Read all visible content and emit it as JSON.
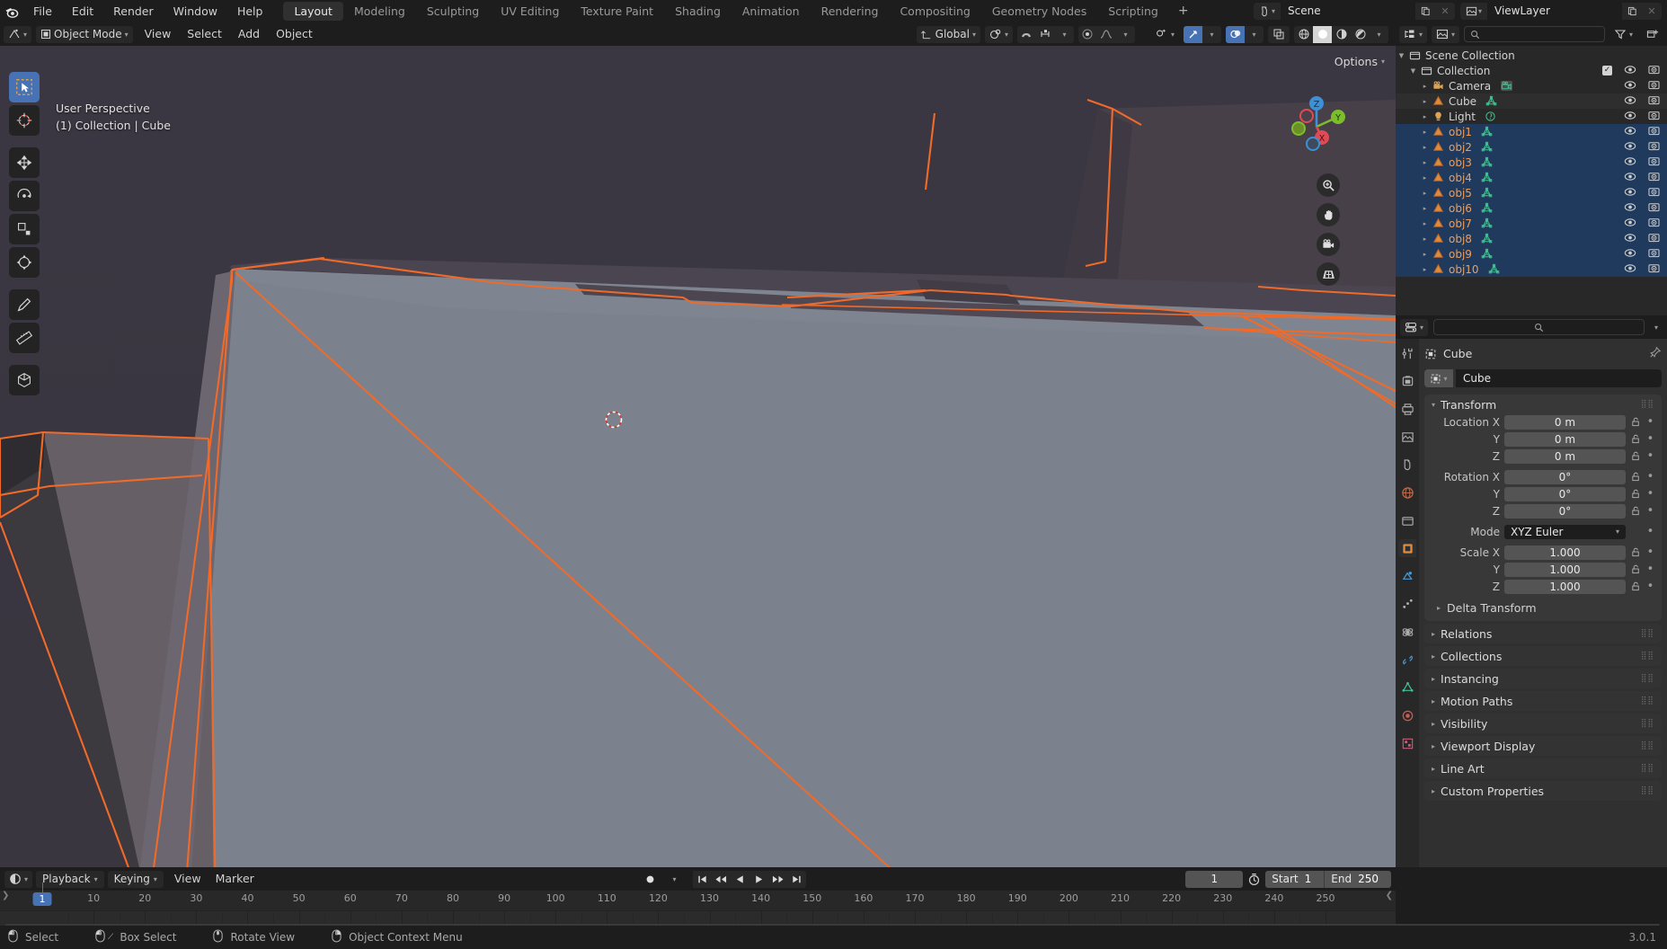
{
  "app": {
    "version": "3.0.1",
    "theme_bg": "#1d1d1d",
    "accent": "#4772b3",
    "select_orange": "#ed9e5c"
  },
  "topbar": {
    "menus": [
      "File",
      "Edit",
      "Render",
      "Window",
      "Help"
    ],
    "workspaces": [
      {
        "label": "Layout",
        "active": true
      },
      {
        "label": "Modeling",
        "active": false
      },
      {
        "label": "Sculpting",
        "active": false
      },
      {
        "label": "UV Editing",
        "active": false
      },
      {
        "label": "Texture Paint",
        "active": false
      },
      {
        "label": "Shading",
        "active": false
      },
      {
        "label": "Animation",
        "active": false
      },
      {
        "label": "Rendering",
        "active": false
      },
      {
        "label": "Compositing",
        "active": false
      },
      {
        "label": "Geometry Nodes",
        "active": false
      },
      {
        "label": "Scripting",
        "active": false
      }
    ],
    "add_workspace": "+",
    "scene_name": "Scene",
    "viewlayer_name": "ViewLayer"
  },
  "viewport": {
    "mode": "Object Mode",
    "menus": [
      "View",
      "Select",
      "Add",
      "Object"
    ],
    "transform_orientation": "Global",
    "options_label": "Options",
    "overlay_text_line1": "User Perspective",
    "overlay_text_line2": "(1) Collection | Cube",
    "gizmo_axes": {
      "x": "X",
      "y": "Y",
      "z": "Z"
    }
  },
  "outliner": {
    "search_placeholder": "",
    "root": "Scene Collection",
    "collection": "Collection",
    "rows": [
      {
        "label": "Camera",
        "icon": "camera-icon",
        "data_icon": "camera-data-icon",
        "selected": false,
        "active": false,
        "indent": 2
      },
      {
        "label": "Cube",
        "icon": "mesh-icon",
        "data_icon": "mesh-data-icon",
        "selected": false,
        "active": true,
        "indent": 2
      },
      {
        "label": "Light",
        "icon": "light-icon",
        "data_icon": "light-data-icon",
        "selected": false,
        "active": false,
        "indent": 2
      },
      {
        "label": "obj1",
        "icon": "mesh-icon",
        "data_icon": "mesh-data-icon",
        "selected": true,
        "active": false,
        "indent": 2
      },
      {
        "label": "obj2",
        "icon": "mesh-icon",
        "data_icon": "mesh-data-icon",
        "selected": true,
        "active": false,
        "indent": 2
      },
      {
        "label": "obj3",
        "icon": "mesh-icon",
        "data_icon": "mesh-data-icon",
        "selected": true,
        "active": false,
        "indent": 2
      },
      {
        "label": "obj4",
        "icon": "mesh-icon",
        "data_icon": "mesh-data-icon",
        "selected": true,
        "active": false,
        "indent": 2
      },
      {
        "label": "obj5",
        "icon": "mesh-icon",
        "data_icon": "mesh-data-icon",
        "selected": true,
        "active": false,
        "indent": 2
      },
      {
        "label": "obj6",
        "icon": "mesh-icon",
        "data_icon": "mesh-data-icon",
        "selected": true,
        "active": false,
        "indent": 2
      },
      {
        "label": "obj7",
        "icon": "mesh-icon",
        "data_icon": "mesh-data-icon",
        "selected": true,
        "active": false,
        "indent": 2
      },
      {
        "label": "obj8",
        "icon": "mesh-icon",
        "data_icon": "mesh-data-icon",
        "selected": true,
        "active": false,
        "indent": 2
      },
      {
        "label": "obj9",
        "icon": "mesh-icon",
        "data_icon": "mesh-data-icon",
        "selected": true,
        "active": false,
        "indent": 2
      },
      {
        "label": "obj10",
        "icon": "mesh-icon",
        "data_icon": "mesh-data-icon",
        "selected": true,
        "active": false,
        "indent": 2
      }
    ]
  },
  "properties": {
    "breadcrumb_object": "Cube",
    "object_name": "Cube",
    "transform": {
      "title": "Transform",
      "location_label": "Location X",
      "rotation_label": "Rotation X",
      "scale_label": "Scale X",
      "axis_y": "Y",
      "axis_z": "Z",
      "location": [
        "0 m",
        "0 m",
        "0 m"
      ],
      "rotation": [
        "0°",
        "0°",
        "0°"
      ],
      "mode_label": "Mode",
      "mode_value": "XYZ Euler",
      "scale": [
        "1.000",
        "1.000",
        "1.000"
      ],
      "delta_transform": "Delta Transform"
    },
    "panels": [
      "Relations",
      "Collections",
      "Instancing",
      "Motion Paths",
      "Visibility",
      "Viewport Display",
      "Line Art",
      "Custom Properties"
    ]
  },
  "timeline": {
    "menus": [
      "View",
      "Marker"
    ],
    "playback": "Playback",
    "keying": "Keying",
    "current_frame": "1",
    "start_label": "Start",
    "start_value": "1",
    "end_label": "End",
    "end_value": "250",
    "playhead_frame": "1",
    "ticks": [
      10,
      20,
      30,
      40,
      50,
      60,
      70,
      80,
      90,
      100,
      110,
      120,
      130,
      140,
      150,
      160,
      170,
      180,
      190,
      200,
      210,
      220,
      230,
      240,
      250
    ]
  },
  "statusbar": {
    "items": [
      {
        "label": "Select",
        "icon": "mouse-left-icon"
      },
      {
        "label": "Box Select",
        "icon": "mouse-left-drag-icon"
      },
      {
        "label": "Rotate View",
        "icon": "mouse-middle-icon"
      },
      {
        "label": "Object Context Menu",
        "icon": "mouse-right-icon"
      }
    ],
    "version": "3.0.1"
  }
}
